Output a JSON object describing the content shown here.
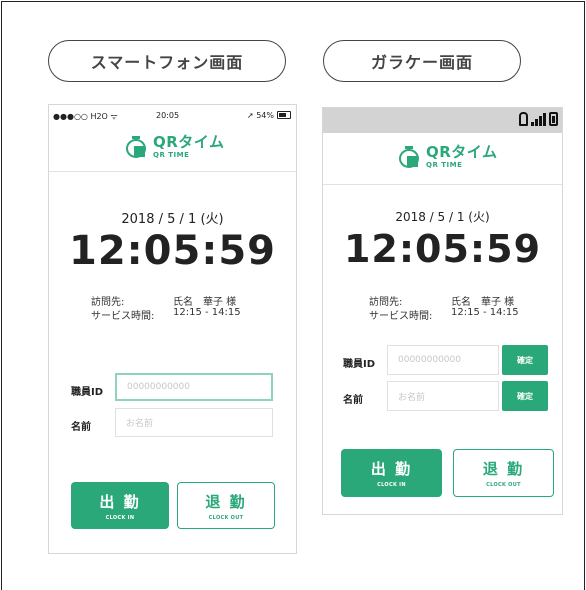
{
  "labels": {
    "smartphone": "スマートフォン画面",
    "feature_phone": "ガラケー画面"
  },
  "phone": {
    "status": {
      "carrier": "●●●○○ H2O ᯤ",
      "time": "20:05",
      "battery": "➚ 54%"
    },
    "logo": {
      "title": "QRタイム",
      "subtitle": "QR TIME"
    },
    "date": "2018 / 5 / 1 (火)",
    "clock": "12:05:59",
    "visit": {
      "label": "訪問先:",
      "value": "氏名　華子 様"
    },
    "service": {
      "label": "サービス時間:",
      "value": "12:15 - 14:15"
    },
    "staff_id": {
      "label": "職員ID",
      "placeholder": "00000000000"
    },
    "name": {
      "label": "名前",
      "placeholder": "お名前"
    },
    "clock_in": {
      "label": "出 勤",
      "sub": "CLOCK IN"
    },
    "clock_out": {
      "label": "退 勤",
      "sub": "CLOCK OUT"
    }
  },
  "feature": {
    "logo": {
      "title": "QRタイム",
      "subtitle": "QR TIME"
    },
    "date": "2018 / 5 / 1 (火)",
    "clock": "12:05:59",
    "visit": {
      "label": "訪問先:",
      "value": "氏名　華子 様"
    },
    "service": {
      "label": "サービス時間:",
      "value": "12:15 - 14:15"
    },
    "staff_id": {
      "label": "職員ID",
      "placeholder": "00000000000",
      "confirm": "確定"
    },
    "name": {
      "label": "名前",
      "placeholder": "お名前",
      "confirm": "確定"
    },
    "clock_in": {
      "label": "出 勤",
      "sub": "CLOCK IN"
    },
    "clock_out": {
      "label": "退 勤",
      "sub": "CLOCK OUT"
    }
  },
  "colors": {
    "accent": "#2aa87a",
    "status_bar": "#d3d3d3",
    "border": "#222222"
  },
  "icons": [
    "timer-logo-icon",
    "signal-icon",
    "battery-icon",
    "antenna-icon"
  ]
}
